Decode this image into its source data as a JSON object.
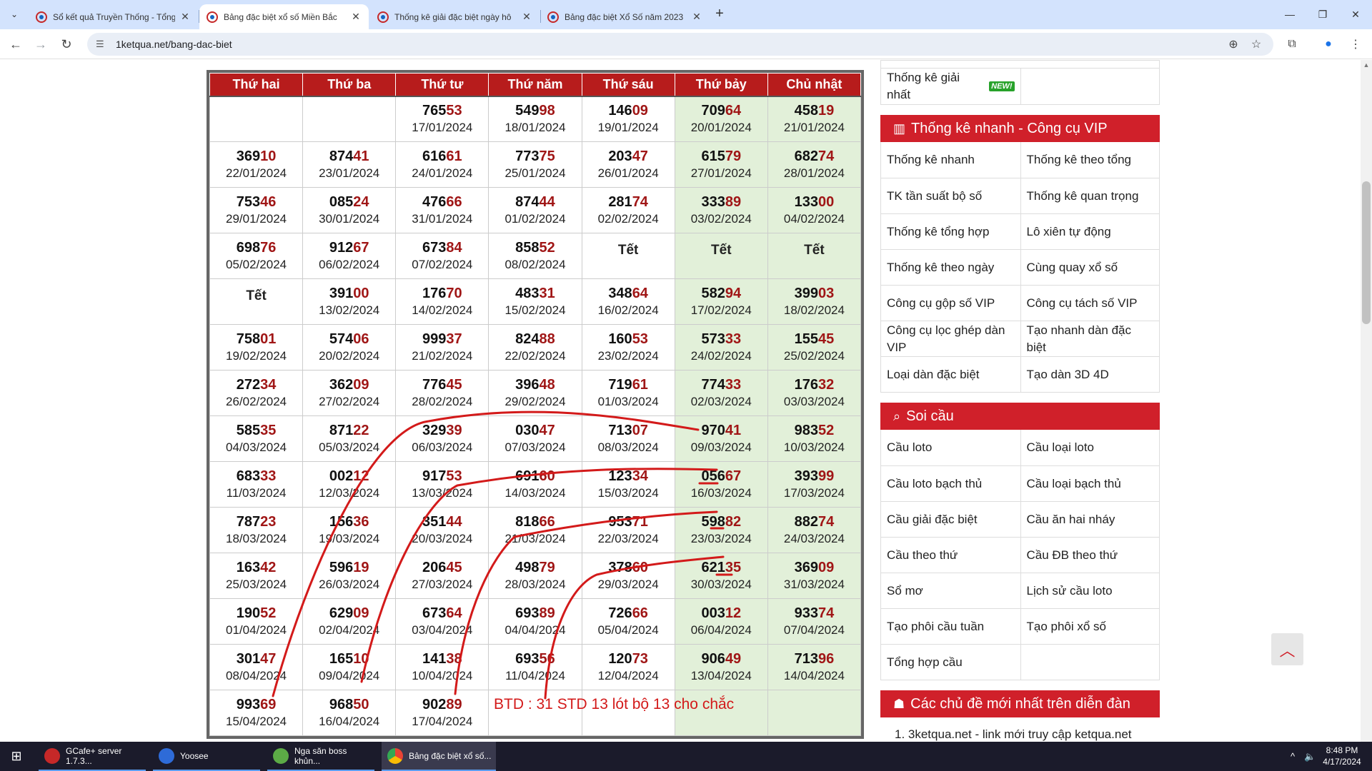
{
  "browser": {
    "tabs": [
      {
        "label": "Sổ kết quả Truyền Thống - Tổng",
        "active": false
      },
      {
        "label": "Bảng đặc biệt xổ số Miền Bắc",
        "active": true
      },
      {
        "label": "Thống kê giải đặc biệt ngày hô",
        "active": false
      },
      {
        "label": "Bảng đặc biệt Xổ Số năm 2023",
        "active": false
      }
    ],
    "url": "1ketqua.net/bang-dac-biet"
  },
  "table": {
    "headers": [
      "Thứ hai",
      "Thứ ba",
      "Thứ tư",
      "Thứ năm",
      "Thứ sáu",
      "Thứ bảy",
      "Chủ nhật"
    ],
    "rows": [
      [
        null,
        null,
        {
          "head": "765",
          "tail": "53",
          "date": "17/01/2024"
        },
        {
          "head": "549",
          "tail": "98",
          "date": "18/01/2024"
        },
        {
          "head": "146",
          "tail": "09",
          "date": "19/01/2024"
        },
        {
          "head": "709",
          "tail": "64",
          "date": "20/01/2024"
        },
        {
          "head": "458",
          "tail": "19",
          "date": "21/01/2024"
        }
      ],
      [
        {
          "head": "369",
          "tail": "10",
          "date": "22/01/2024"
        },
        {
          "head": "874",
          "tail": "41",
          "date": "23/01/2024"
        },
        {
          "head": "616",
          "tail": "61",
          "date": "24/01/2024"
        },
        {
          "head": "773",
          "tail": "75",
          "date": "25/01/2024"
        },
        {
          "head": "203",
          "tail": "47",
          "date": "26/01/2024"
        },
        {
          "head": "615",
          "tail": "79",
          "date": "27/01/2024"
        },
        {
          "head": "682",
          "tail": "74",
          "date": "28/01/2024"
        }
      ],
      [
        {
          "head": "753",
          "tail": "46",
          "date": "29/01/2024"
        },
        {
          "head": "085",
          "tail": "24",
          "date": "30/01/2024"
        },
        {
          "head": "476",
          "tail": "66",
          "date": "31/01/2024"
        },
        {
          "head": "874",
          "tail": "44",
          "date": "01/02/2024"
        },
        {
          "head": "281",
          "tail": "74",
          "date": "02/02/2024"
        },
        {
          "head": "333",
          "tail": "89",
          "date": "03/02/2024"
        },
        {
          "head": "133",
          "tail": "00",
          "date": "04/02/2024"
        }
      ],
      [
        {
          "head": "698",
          "tail": "76",
          "date": "05/02/2024"
        },
        {
          "head": "912",
          "tail": "67",
          "date": "06/02/2024"
        },
        {
          "head": "673",
          "tail": "84",
          "date": "07/02/2024"
        },
        {
          "head": "858",
          "tail": "52",
          "date": "08/02/2024"
        },
        {
          "tet": "Tết"
        },
        {
          "tet": "Tết"
        },
        {
          "tet": "Tết"
        }
      ],
      [
        {
          "tet": "Tết"
        },
        {
          "head": "391",
          "tail": "00",
          "date": "13/02/2024"
        },
        {
          "head": "176",
          "tail": "70",
          "date": "14/02/2024"
        },
        {
          "head": "483",
          "tail": "31",
          "date": "15/02/2024"
        },
        {
          "head": "348",
          "tail": "64",
          "date": "16/02/2024"
        },
        {
          "head": "582",
          "tail": "94",
          "date": "17/02/2024"
        },
        {
          "head": "399",
          "tail": "03",
          "date": "18/02/2024"
        }
      ],
      [
        {
          "head": "758",
          "tail": "01",
          "date": "19/02/2024"
        },
        {
          "head": "574",
          "tail": "06",
          "date": "20/02/2024"
        },
        {
          "head": "999",
          "tail": "37",
          "date": "21/02/2024"
        },
        {
          "head": "824",
          "tail": "88",
          "date": "22/02/2024"
        },
        {
          "head": "160",
          "tail": "53",
          "date": "23/02/2024"
        },
        {
          "head": "573",
          "tail": "33",
          "date": "24/02/2024"
        },
        {
          "head": "155",
          "tail": "45",
          "date": "25/02/2024"
        }
      ],
      [
        {
          "head": "272",
          "tail": "34",
          "date": "26/02/2024"
        },
        {
          "head": "362",
          "tail": "09",
          "date": "27/02/2024"
        },
        {
          "head": "776",
          "tail": "45",
          "date": "28/02/2024"
        },
        {
          "head": "396",
          "tail": "48",
          "date": "29/02/2024"
        },
        {
          "head": "719",
          "tail": "61",
          "date": "01/03/2024"
        },
        {
          "head": "774",
          "tail": "33",
          "date": "02/03/2024"
        },
        {
          "head": "176",
          "tail": "32",
          "date": "03/03/2024"
        }
      ],
      [
        {
          "head": "585",
          "tail": "35",
          "date": "04/03/2024"
        },
        {
          "head": "871",
          "tail": "22",
          "date": "05/03/2024"
        },
        {
          "head": "329",
          "tail": "39",
          "date": "06/03/2024"
        },
        {
          "head": "030",
          "tail": "47",
          "date": "07/03/2024"
        },
        {
          "head": "713",
          "tail": "07",
          "date": "08/03/2024"
        },
        {
          "head": "970",
          "tail": "41",
          "date": "09/03/2024"
        },
        {
          "head": "983",
          "tail": "52",
          "date": "10/03/2024"
        }
      ],
      [
        {
          "head": "683",
          "tail": "33",
          "date": "11/03/2024"
        },
        {
          "head": "002",
          "tail": "12",
          "date": "12/03/2024"
        },
        {
          "head": "917",
          "tail": "53",
          "date": "13/03/2024"
        },
        {
          "head": "691",
          "tail": "60",
          "date": "14/03/2024"
        },
        {
          "head": "123",
          "tail": "34",
          "date": "15/03/2024"
        },
        {
          "head": "056",
          "tail": "67",
          "date": "16/03/2024"
        },
        {
          "head": "393",
          "tail": "99",
          "date": "17/03/2024"
        }
      ],
      [
        {
          "head": "787",
          "tail": "23",
          "date": "18/03/2024"
        },
        {
          "head": "156",
          "tail": "36",
          "date": "19/03/2024"
        },
        {
          "head": "351",
          "tail": "44",
          "date": "20/03/2024"
        },
        {
          "head": "818",
          "tail": "66",
          "date": "21/03/2024"
        },
        {
          "head": "953",
          "tail": "71",
          "date": "22/03/2024"
        },
        {
          "head": "598",
          "tail": "82",
          "date": "23/03/2024"
        },
        {
          "head": "882",
          "tail": "74",
          "date": "24/03/2024"
        }
      ],
      [
        {
          "head": "163",
          "tail": "42",
          "date": "25/03/2024"
        },
        {
          "head": "596",
          "tail": "19",
          "date": "26/03/2024"
        },
        {
          "head": "206",
          "tail": "45",
          "date": "27/03/2024"
        },
        {
          "head": "498",
          "tail": "79",
          "date": "28/03/2024"
        },
        {
          "head": "378",
          "tail": "60",
          "date": "29/03/2024"
        },
        {
          "head": "621",
          "tail": "35",
          "date": "30/03/2024"
        },
        {
          "head": "369",
          "tail": "09",
          "date": "31/03/2024"
        }
      ],
      [
        {
          "head": "190",
          "tail": "52",
          "date": "01/04/2024"
        },
        {
          "head": "629",
          "tail": "09",
          "date": "02/04/2024"
        },
        {
          "head": "673",
          "tail": "64",
          "date": "03/04/2024"
        },
        {
          "head": "693",
          "tail": "89",
          "date": "04/04/2024"
        },
        {
          "head": "726",
          "tail": "66",
          "date": "05/04/2024"
        },
        {
          "head": "003",
          "tail": "12",
          "date": "06/04/2024"
        },
        {
          "head": "933",
          "tail": "74",
          "date": "07/04/2024"
        }
      ],
      [
        {
          "head": "301",
          "tail": "47",
          "date": "08/04/2024"
        },
        {
          "head": "165",
          "tail": "10",
          "date": "09/04/2024"
        },
        {
          "head": "141",
          "tail": "38",
          "date": "10/04/2024"
        },
        {
          "head": "693",
          "tail": "56",
          "date": "11/04/2024"
        },
        {
          "head": "120",
          "tail": "73",
          "date": "12/04/2024"
        },
        {
          "head": "906",
          "tail": "49",
          "date": "13/04/2024"
        },
        {
          "head": "713",
          "tail": "96",
          "date": "14/04/2024"
        }
      ],
      [
        {
          "head": "993",
          "tail": "69",
          "date": "15/04/2024"
        },
        {
          "head": "968",
          "tail": "50",
          "date": "16/04/2024"
        },
        {
          "head": "902",
          "tail": "89",
          "date": "17/04/2024"
        },
        null,
        null,
        null,
        null
      ]
    ]
  },
  "annotation": {
    "note": "BTD : 31 STD 13 lót bộ 13 cho chắc",
    "color": "#d31a1a"
  },
  "sidebar": {
    "top_rows": [
      [
        "Thống kê giải nhất",
        ""
      ]
    ],
    "new_badge": "NEW!",
    "quick_title": "Thống kê nhanh - Công cụ VIP",
    "quick_links": [
      [
        "Thống kê nhanh",
        "Thống kê theo tổng"
      ],
      [
        "TK tần suất bộ số",
        "Thống kê quan trọng"
      ],
      [
        "Thống kê tổng hợp",
        "Lô xiên tự động"
      ],
      [
        "Thống kê theo ngày",
        "Cùng quay xổ số"
      ],
      [
        "Công cụ gộp số VIP",
        "Công cụ tách số VIP"
      ],
      [
        "Công cụ lọc ghép dàn VIP",
        "Tạo nhanh dàn đặc biệt"
      ],
      [
        "Loại dàn đặc biệt",
        "Tạo dàn 3D 4D"
      ]
    ],
    "soicau_title": "Soi cầu",
    "soicau_links": [
      [
        "Cầu loto",
        "Cầu loại loto"
      ],
      [
        "Cầu loto bạch thủ",
        "Cầu loại bạch thủ"
      ],
      [
        "Cầu giải đặc biệt",
        "Cầu ăn hai nháy"
      ],
      [
        "Cầu theo thứ",
        "Cầu ĐB theo thứ"
      ],
      [
        "Sổ mơ",
        "Lịch sử cầu loto"
      ],
      [
        "Tạo phôi cầu tuần",
        "Tạo phôi xổ số"
      ],
      [
        "Tổng hợp cầu",
        ""
      ]
    ],
    "forum_title": "Các chủ đề mới nhất trên diễn đàn",
    "forum_first": "1. 3ketqua.net - link mới truy cập ketqua.net"
  },
  "taskbar": {
    "items": [
      {
        "label": "GCafe+ server 1.7.3..."
      },
      {
        "label": "Yoosee"
      },
      {
        "label": "Nga săn boss khủn..."
      },
      {
        "label": "Bảng đặc biệt xổ số..."
      }
    ],
    "time": "8:48 PM",
    "date": "4/17/2024"
  },
  "icons": {
    "tab_search": "chevron-down-icon",
    "reload": "reload-icon",
    "zoom": "zoom-icon",
    "star": "star-icon",
    "extensions": "puzzle-icon",
    "profile": "profile-icon",
    "menu": "kebab-menu-icon"
  }
}
